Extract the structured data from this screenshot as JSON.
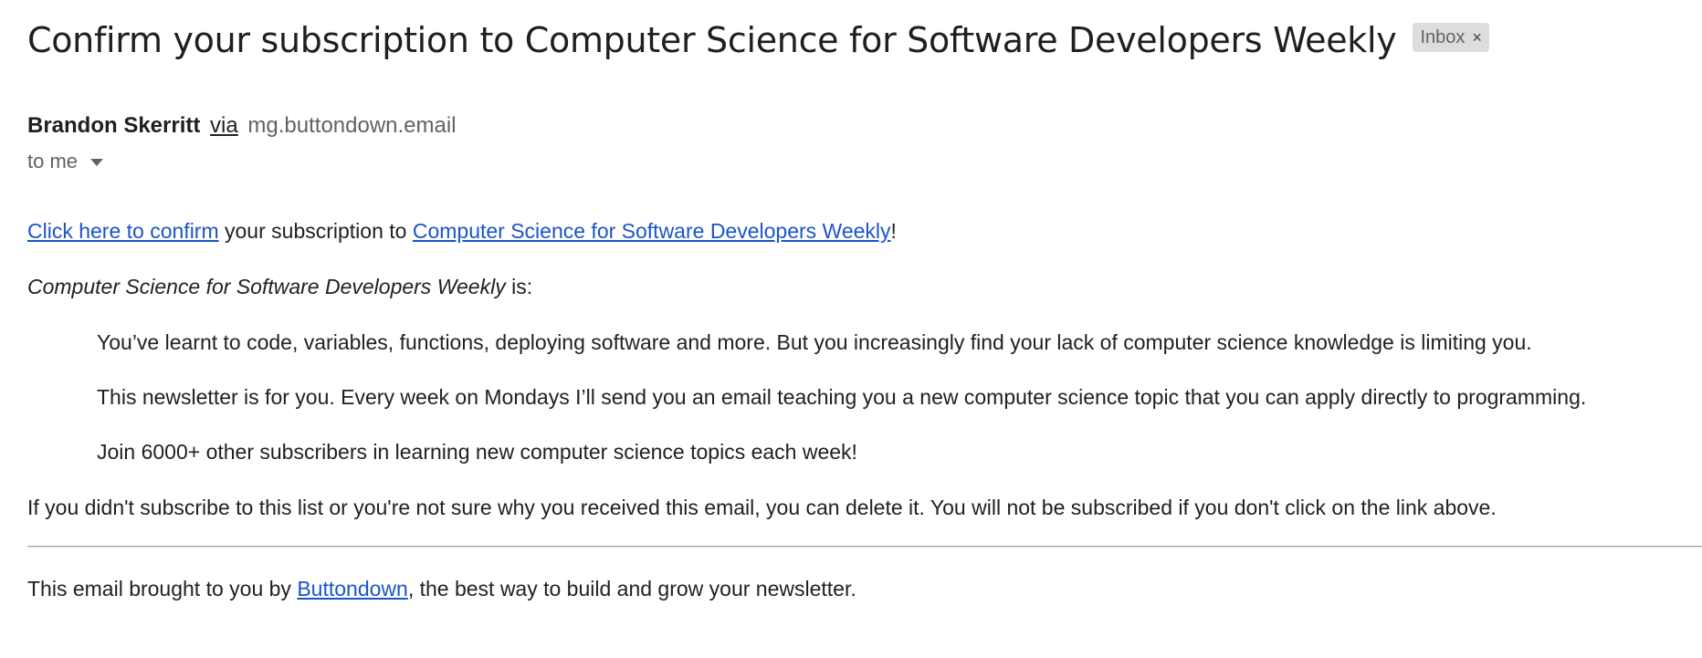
{
  "email": {
    "subject": "Confirm your subscription to Computer Science for Software Developers Weekly",
    "label": "Inbox",
    "label_close": "×",
    "sender_name": "Brandon Skerritt",
    "via": "via",
    "sender_domain": "mg.buttondown.email",
    "recipient": "to me"
  },
  "body": {
    "confirm_link": "Click here to confirm",
    "confirm_middle": " your subscription to ",
    "newsletter_link": "Computer Science for Software Developers Weekly",
    "confirm_end": "!",
    "intro_italic": "Computer Science for Software Developers Weekly",
    "intro_rest": " is:",
    "quote_1": "You’ve learnt to code, variables, functions, deploying software and more. But you increasingly find your lack of computer science knowledge is limiting you.",
    "quote_2": "This newsletter is for you. Every week on Mondays I’ll send you an email teaching you a new computer science topic that you can apply directly to programming.",
    "quote_3": "Join 6000+ other subscribers in learning new computer science topics each week!",
    "disclaimer": "If you didn't subscribe to this list or you're not sure why you received this email, you can delete it. You will not be subscribed if you don't click on the link above.",
    "footer_prefix": "This email brought to you by ",
    "footer_link": "Buttondown",
    "footer_suffix": ", the best way to build and grow your newsletter."
  },
  "colors": {
    "link": "#1a55c9",
    "label_bg": "#dddddd",
    "muted_text": "#5f6368"
  },
  "icons": {
    "label_remove": "close-icon",
    "recipient_details": "caret-down-icon"
  }
}
